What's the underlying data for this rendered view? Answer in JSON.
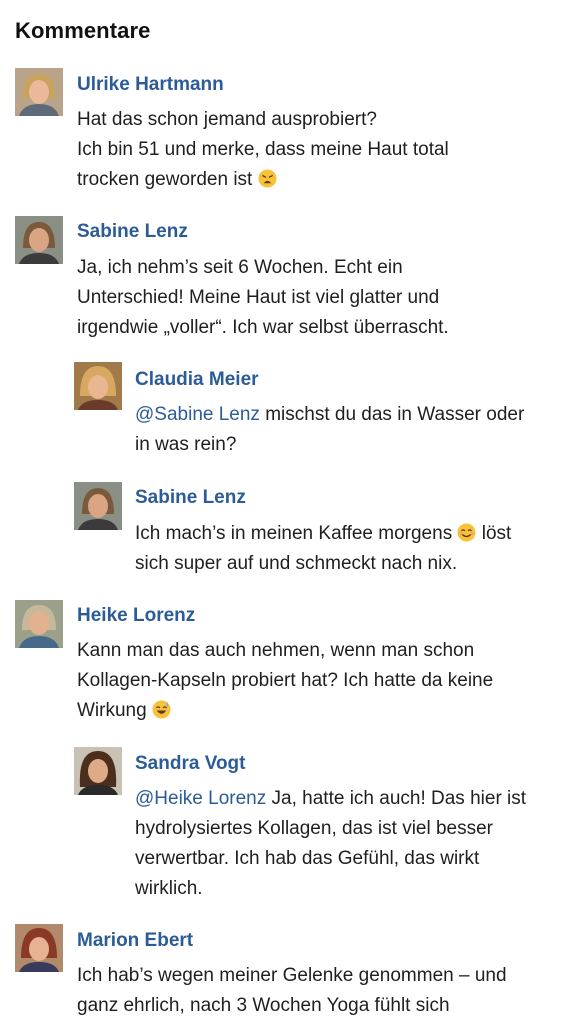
{
  "section_title": "Kommentare",
  "comments": [
    {
      "name": "Ulrike Hartmann",
      "lines": [
        "Hat das schon jemand ausprobiert?",
        "Ich bin 51 und merke, dass meine Haut total",
        "trocken geworden ist"
      ],
      "emoji": "weary-face-emoji"
    },
    {
      "name": "Sabine Lenz",
      "lines": [
        "Ja, ich nehm’s seit 6 Wochen. Echt ein",
        "Unterschied! Meine Haut ist viel glatter und",
        "irgendwie „voller“. Ich war selbst überrascht."
      ]
    },
    {
      "name": "Claudia Meier",
      "mention": "@Sabine Lenz",
      "lines": [
        " mischst du das in Wasser oder",
        "in was rein?"
      ]
    },
    {
      "name": "Sabine Lenz",
      "lines": [
        "Ich mach’s in meinen Kaffee morgens",
        " löst",
        "sich super auf und schmeckt nach nix."
      ],
      "emoji": "smiling-face-emoji"
    },
    {
      "name": "Heike Lorenz",
      "lines": [
        "Kann man das auch nehmen, wenn man schon",
        "Kollagen-Kapseln probiert hat? Ich hatte da keine",
        "Wirkung"
      ],
      "emoji": "grinning-sweat-emoji"
    },
    {
      "name": "Sandra Vogt",
      "mention": "@Heike Lorenz",
      "lines": [
        " Ja, hatte ich auch! Das hier ist",
        "hydrolysiertes Kollagen, das ist viel besser",
        "verwertbar. Ich hab das Gefühl, das wirkt",
        "wirklich."
      ]
    },
    {
      "name": "Marion Ebert",
      "lines": [
        "Ich hab’s wegen meiner Gelenke genommen – und",
        "ganz ehrlich, nach 3 Wochen Yoga fühlt sich"
      ]
    }
  ]
}
